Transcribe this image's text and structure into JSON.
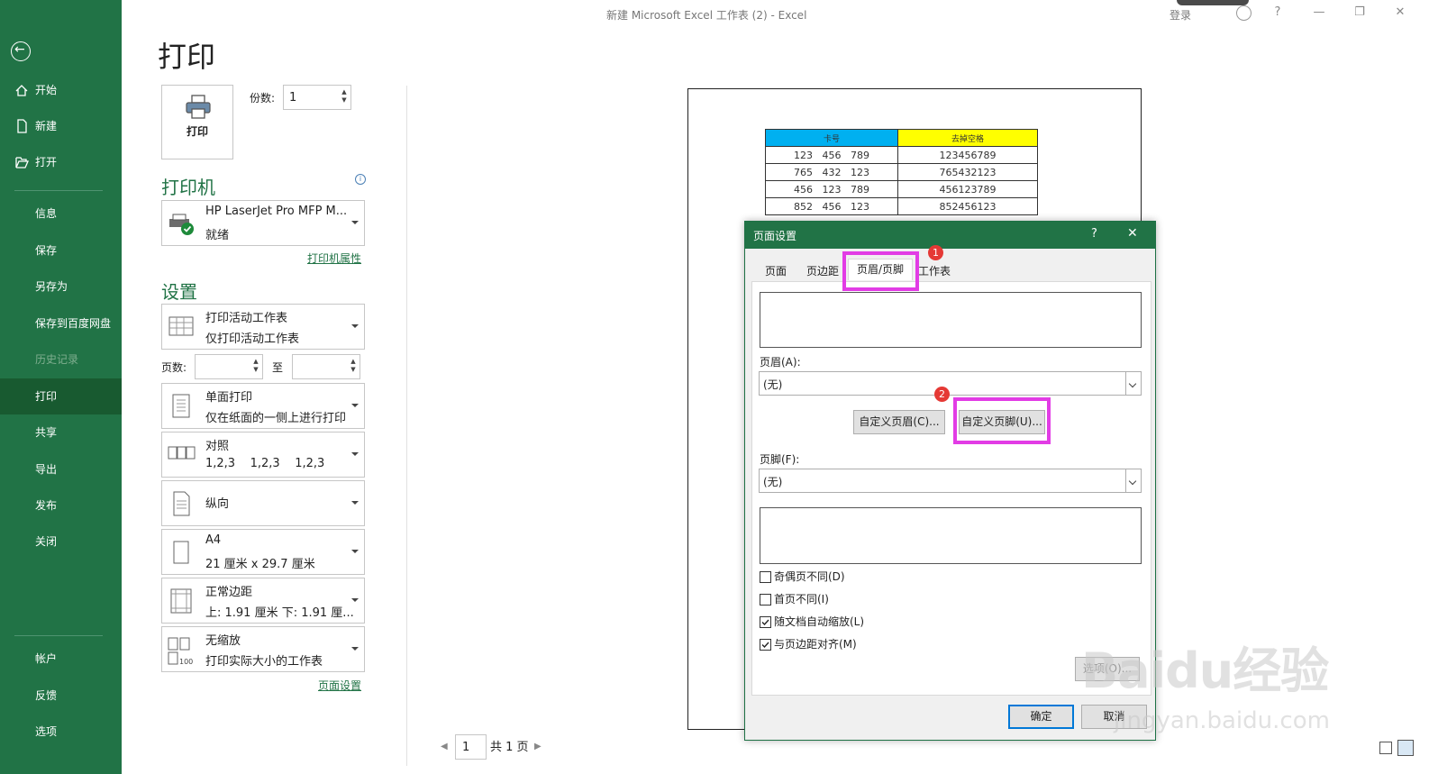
{
  "window": {
    "title": "新建 Microsoft Excel 工作表 (2)  -  Excel",
    "signin": "登录",
    "help": "?",
    "minimize": "—",
    "restore": "❐",
    "close": "✕"
  },
  "sidebar": {
    "back": "←",
    "items": [
      {
        "label": "开始",
        "icon": "home-icon"
      },
      {
        "label": "新建",
        "icon": "new-file-icon"
      },
      {
        "label": "打开",
        "icon": "open-folder-icon"
      },
      {
        "label": "信息"
      },
      {
        "label": "保存"
      },
      {
        "label": "另存为"
      },
      {
        "label": "保存到百度网盘"
      },
      {
        "label": "历史记录"
      },
      {
        "label": "打印"
      },
      {
        "label": "共享"
      },
      {
        "label": "导出"
      },
      {
        "label": "发布"
      },
      {
        "label": "关闭"
      },
      {
        "label": "帐户"
      },
      {
        "label": "反馈"
      },
      {
        "label": "选项"
      }
    ]
  },
  "print": {
    "title": "打印",
    "print_button": "打印",
    "copies_label": "份数:",
    "copies_value": "1",
    "printer_section": "打印机",
    "printer_name": "HP LaserJet Pro MFP M...",
    "printer_status": "就绪",
    "printer_properties": "打印机属性",
    "settings_section": "设置",
    "settings": [
      {
        "line1": "打印活动工作表",
        "line2": "仅打印活动工作表"
      },
      {
        "line1": "单面打印",
        "line2": "仅在纸面的一侧上进行打印"
      },
      {
        "line1": "对照",
        "line2": "1,2,3    1,2,3    1,2,3"
      },
      {
        "line1": "纵向",
        "line2": ""
      },
      {
        "line1": "A4",
        "line2": "21 厘米 x 29.7 厘米"
      },
      {
        "line1": "正常边距",
        "line2": "上: 1.91 厘米 下: 1.91 厘..."
      },
      {
        "line1": "无缩放",
        "line2": "打印实际大小的工作表"
      }
    ],
    "pages_label": "页数:",
    "pages_to": "至",
    "page_setup_link": "页面设置"
  },
  "preview": {
    "headers": [
      "卡号",
      "去掉空格"
    ],
    "header_colors": [
      "#00b0f0",
      "#ffff00"
    ],
    "rows": [
      [
        "123   456   789",
        "123456789"
      ],
      [
        "765   432   123",
        "765432123"
      ],
      [
        "456   123   789",
        "456123789"
      ],
      [
        "852   456   123",
        "852456123"
      ]
    ],
    "page_current": "1",
    "page_total": "共 1 页"
  },
  "dialog": {
    "title": "页面设置",
    "help": "?",
    "close": "✕",
    "tabs": [
      "页面",
      "页边距",
      "页眉/页脚",
      "工作表"
    ],
    "header_label": "页眉(A):",
    "header_value": "(无)",
    "custom_header": "自定义页眉(C)...",
    "custom_footer": "自定义页脚(U)...",
    "footer_label": "页脚(F):",
    "footer_value": "(无)",
    "checkboxes": [
      {
        "label": "奇偶页不同(D)",
        "checked": false
      },
      {
        "label": "首页不同(I)",
        "checked": false
      },
      {
        "label": "随文档自动缩放(L)",
        "checked": true
      },
      {
        "label": "与页边距对齐(M)",
        "checked": true
      }
    ],
    "options": "选项(O)...",
    "ok": "确定",
    "cancel": "取消",
    "badge1": "1",
    "badge2": "2",
    "highlight_color": "#e23ce5"
  },
  "watermark": {
    "brand": "Baidu经验",
    "url": "jingyan.baidu.com"
  }
}
